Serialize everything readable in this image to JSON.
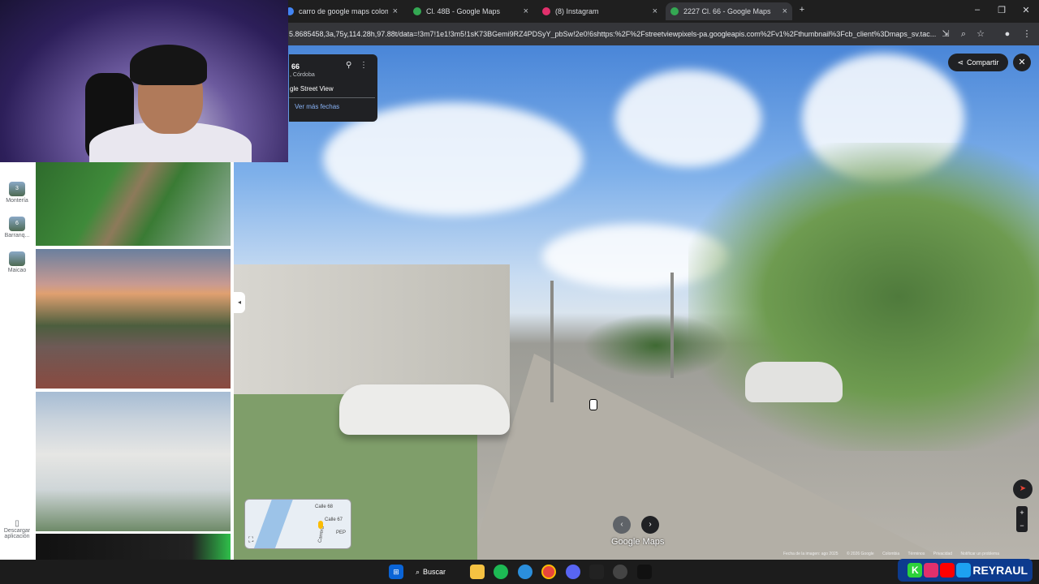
{
  "browser": {
    "tabs": [
      {
        "label": "carro de google maps colombia",
        "favicon_color": "#4285f4"
      },
      {
        "label": "Cl. 48B - Google Maps",
        "favicon_color": "#34a853"
      },
      {
        "label": "(8) Instagram",
        "favicon_color": "#e1306c"
      },
      {
        "label": "2227 Cl. 66 - Google Maps",
        "favicon_color": "#34a853",
        "active": true
      }
    ],
    "new_tab": "+",
    "url": "5.8685458,3a,75y,114.28h,97.88t/data=!3m7!1e1!3m5!1sK73BGemi9RZ4PDSyY_pbSw!2e0!6shttps:%2F%2Fstreetviewpixels-pa.googleapis.com%2Fv1%2Fthumbnail%3Fcb_client%3Dmaps_sv.tac..."
  },
  "info_card": {
    "title": "66",
    "place": ", Córdoba",
    "source": "gle Street View",
    "dates_link": "Ver más fechas"
  },
  "share_label": "Compartir",
  "left_strip": {
    "items": [
      {
        "label": "Montería",
        "thumb": "3"
      },
      {
        "label": "Barranq...",
        "thumb": "6"
      },
      {
        "label": "Maicao",
        "thumb": ""
      }
    ],
    "download": "Descargar aplicación"
  },
  "minimap": {
    "labels": [
      "Calle 68",
      "Calle 67",
      "Carrera",
      "PEP"
    ]
  },
  "branding": {
    "google_maps": "Google Maps"
  },
  "footer": {
    "date": "Fecha de la imagen: ago 2025",
    "copyright": "© 2026 Google",
    "country": "Colombia",
    "terms": "Términos",
    "privacy": "Privacidad",
    "report": "Notificar un problema"
  },
  "taskbar": {
    "search_label": "Buscar",
    "brand": "REYRAUL",
    "brand_prefix": "K"
  },
  "colors": {
    "accent_link": "#8ab4f8",
    "card_bg": "#202124"
  }
}
